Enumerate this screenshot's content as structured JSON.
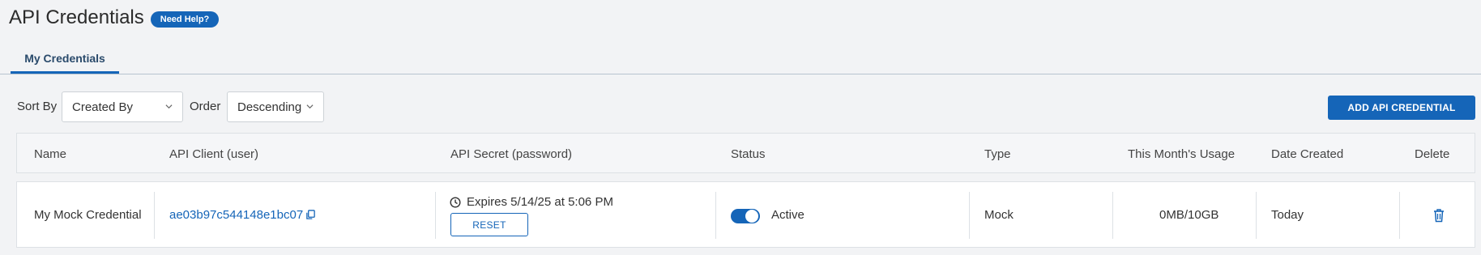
{
  "header": {
    "title": "API Credentials",
    "help_label": "Need Help?"
  },
  "tabs": [
    {
      "label": "My Credentials",
      "active": true
    }
  ],
  "filters": {
    "sort_by_label": "Sort By",
    "sort_by_value": "Created By",
    "order_label": "Order",
    "order_value": "Descending"
  },
  "actions": {
    "add_label": "ADD API CREDENTIAL"
  },
  "table": {
    "columns": [
      "Name",
      "API Client (user)",
      "API Secret (password)",
      "Status",
      "Type",
      "This Month's Usage",
      "Date Created",
      "Delete"
    ],
    "rows": [
      {
        "name": "My Mock Credential",
        "client": "ae03b97c544148e1bc07",
        "expires": "Expires 5/14/25 at 5:06 PM",
        "reset_label": "RESET",
        "status": "Active",
        "status_on": true,
        "type": "Mock",
        "usage": "0MB/10GB",
        "date_created": "Today"
      }
    ]
  },
  "colors": {
    "accent": "#1565b8",
    "background": "#f2f3f5",
    "border": "#dde1e5"
  },
  "icons": {
    "copy": "copy-icon",
    "clock": "clock-icon",
    "delete": "trash-icon",
    "dropdown": "chevron-down-icon"
  }
}
